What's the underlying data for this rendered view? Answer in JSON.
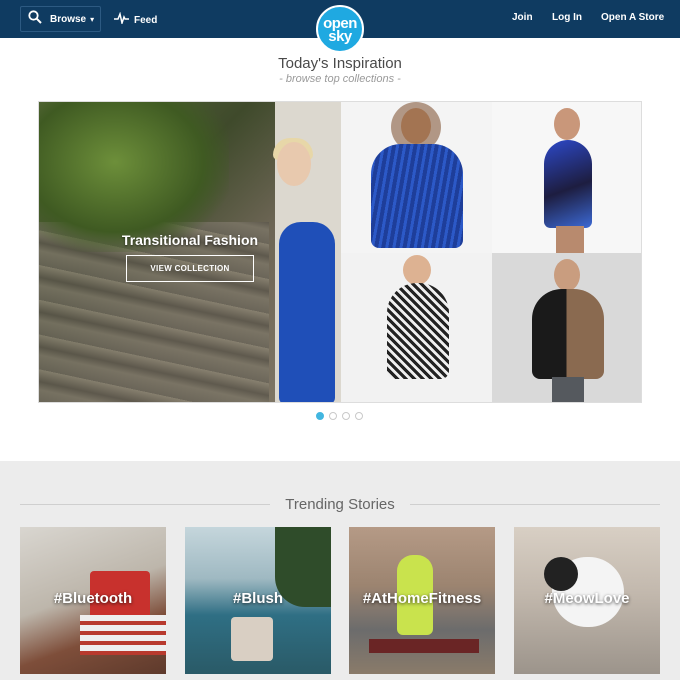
{
  "header": {
    "browse_label": "Browse",
    "browse_caret": "▾",
    "feed_label": "Feed",
    "logo_top": "open",
    "logo_bottom": "sky",
    "nav": {
      "join": "Join",
      "login": "Log In",
      "open_store": "Open A Store"
    },
    "bg_color": "#0f3b61",
    "logo_color": "#1fa9e1"
  },
  "inspiration": {
    "title": "Today's Inspiration",
    "subtitle": "- browse top collections -",
    "hero_title": "Transitional Fashion",
    "hero_button": "VIEW COLLECTION",
    "carousel_dots": 4,
    "active_dot": 1,
    "dot_active_color": "#42b6e0"
  },
  "trending": {
    "title": "Trending Stories",
    "stories": [
      {
        "tag": "#Bluetooth"
      },
      {
        "tag": "#Blush"
      },
      {
        "tag": "#AtHomeFitness"
      },
      {
        "tag": "#MeowLove"
      }
    ]
  }
}
